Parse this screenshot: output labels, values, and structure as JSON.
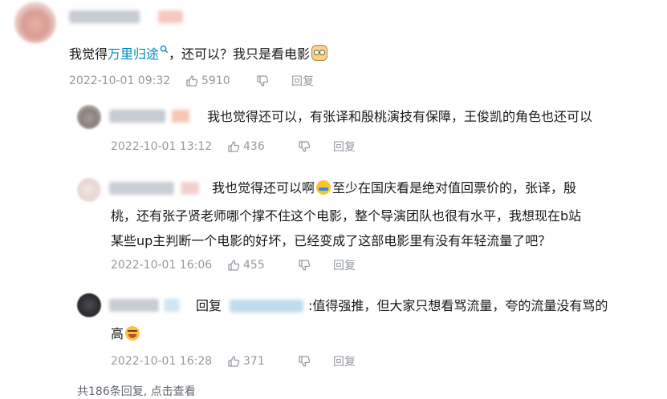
{
  "main_comment": {
    "text_before": "我觉得",
    "link": "万里归途",
    "link_icon": "search-icon",
    "text_after": "，还可以？我只是看电影",
    "emoji": "thinking-face",
    "time": "2022-10-01 09:32",
    "likes": "5910",
    "reply_label": "回复"
  },
  "replies": [
    {
      "text": "我也觉得还可以，有张译和殷桃演技有保障，王俊凯的角色也还可以",
      "time": "2022-10-01 13:12",
      "likes": "436",
      "reply_label": "回复"
    },
    {
      "line1": "我也觉得还可以啊",
      "emoji": "crying-face",
      "line1_after": "至少在国庆看是绝对值回票价的，张译，殷",
      "line2": "桃，还有张子贤老师哪个撑不住这个电影，整个导演团队也很有水平，我想现在b站",
      "line3": "某些up主判断一个电影的好坏，已经变成了这部电影里有没有年轻流量了吧？",
      "time": "2022-10-01 16:06",
      "likes": "455",
      "reply_label": "回复"
    },
    {
      "reply_prefix": "回复",
      "text_after": ":值得强推，但大家只想看骂流量，夸的流量没有骂的",
      "line2": "高",
      "emoji": "laughing-face",
      "time": "2022-10-01 16:28",
      "likes": "371",
      "reply_label": "回复"
    }
  ],
  "footer": {
    "more_replies": "共186条回复, 点击查看"
  },
  "colors": {
    "link": "#008ac5",
    "meta": "#9499a0",
    "text": "#18191c"
  }
}
